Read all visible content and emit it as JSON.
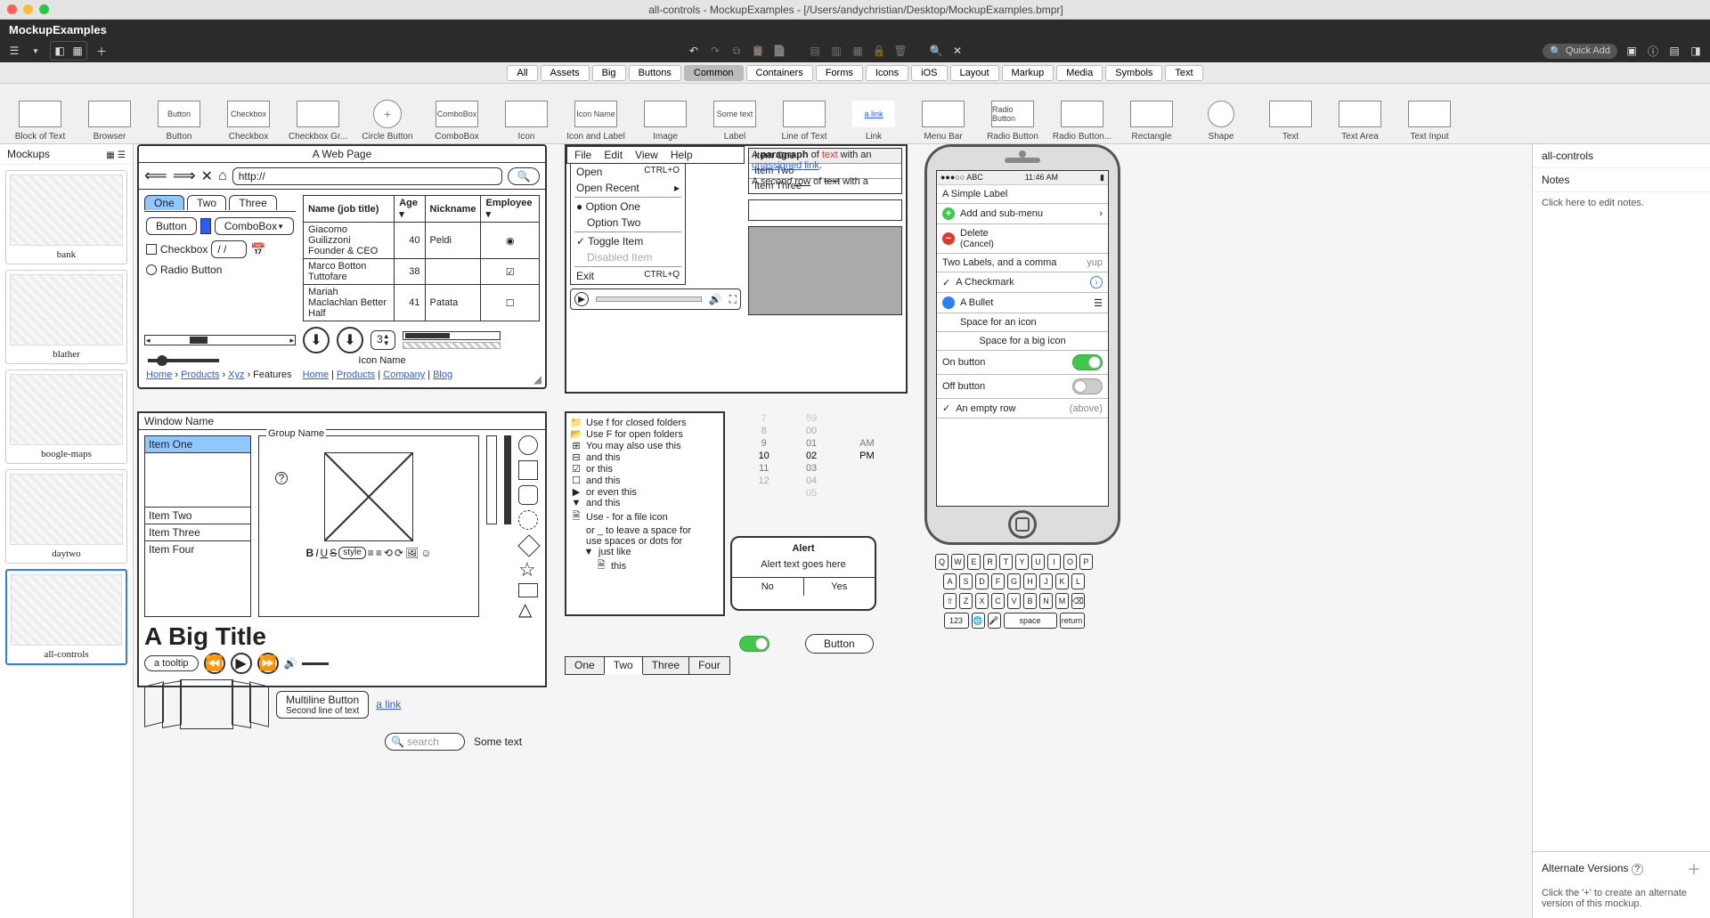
{
  "window": {
    "title": "all-controls - MockupExamples - [/Users/andychristian/Desktop/MockupExamples.bmpr]",
    "app_name": "MockupExamples"
  },
  "quick_add": {
    "placeholder": "Quick Add"
  },
  "categories": [
    "All",
    "Assets",
    "Big",
    "Buttons",
    "Common",
    "Containers",
    "Forms",
    "Icons",
    "iOS",
    "Layout",
    "Markup",
    "Media",
    "Symbols",
    "Text"
  ],
  "controls_strip": [
    {
      "label": "Block of Text"
    },
    {
      "label": "Browser"
    },
    {
      "label": "Button",
      "btn": "Button"
    },
    {
      "label": "Checkbox",
      "btn": "Checkbox"
    },
    {
      "label": "Checkbox Gr..."
    },
    {
      "label": "Circle Button"
    },
    {
      "label": "ComboBox",
      "btn": "ComboBox"
    },
    {
      "label": "Icon"
    },
    {
      "label": "Icon and Label",
      "sub": "Icon Name"
    },
    {
      "label": "Image"
    },
    {
      "label": "Label",
      "sub": "Some text"
    },
    {
      "label": "Line of Text"
    },
    {
      "label": "Link",
      "sub": "a link"
    },
    {
      "label": "Menu Bar"
    },
    {
      "label": "Radio Button",
      "sub": "Radio Button"
    },
    {
      "label": "Radio Button..."
    },
    {
      "label": "Rectangle"
    },
    {
      "label": "Shape"
    },
    {
      "label": "Text"
    },
    {
      "label": "Text Area"
    },
    {
      "label": "Text Input"
    }
  ],
  "mockups": {
    "title": "Mockups",
    "items": [
      "bank",
      "blather",
      "boogle-maps",
      "daytwo",
      "all-controls"
    ],
    "selected": "all-controls"
  },
  "notes": {
    "doc_title": "all-controls",
    "heading": "Notes",
    "placeholder": "Click here to edit notes.",
    "alt_title": "Alternate Versions",
    "alt_help": "Click the '+' to create an alternate version of this mockup."
  },
  "webpage": {
    "title": "A Web Page",
    "url": "http://",
    "tabs": [
      "One",
      "Two",
      "Three"
    ],
    "button": "Button",
    "combobox": "ComboBox",
    "checkbox": "Checkbox",
    "date": "/  /",
    "radio": "Radio Button",
    "table": {
      "headers": [
        "Name (job title)",
        "Age",
        "Nickname",
        "Employee"
      ],
      "rows": [
        [
          "Giacomo Guilizzoni Founder & CEO",
          "40",
          "Peldi",
          "radio-on"
        ],
        [
          "Marco Botton Tuttofare",
          "38",
          "",
          "check-on"
        ],
        [
          "Mariah Maclachlan Better Half",
          "41",
          "Patata",
          "check-off"
        ]
      ]
    },
    "stepper": "3",
    "icon_name": "Icon Name",
    "breadcrumb": [
      "Home",
      "Products",
      "Xyz",
      "Features"
    ],
    "nav": [
      "Home",
      "Products",
      "Company",
      "Blog"
    ]
  },
  "menubar": {
    "items": [
      "File",
      "Edit",
      "View",
      "Help"
    ],
    "menu": [
      {
        "label": "Open",
        "accel": "CTRL+O"
      },
      {
        "label": "Open Recent",
        "sub": true
      },
      {
        "label": "Option One",
        "radio": true,
        "checked": true
      },
      {
        "label": "Option Two",
        "radio": true
      },
      {
        "label": "Toggle Item",
        "check": true,
        "checked": true
      },
      {
        "label": "Disabled Item",
        "disabled": true
      },
      {
        "label": "Exit",
        "accel": "CTRL+Q"
      }
    ],
    "list": [
      "Item One",
      "Item Two",
      "Item Three"
    ],
    "para1_pre": "A ",
    "para1_b": "paragraph",
    "para1_mid": " of ",
    "para1_red": "text",
    "para1_post": " with an ",
    "para1_link": "unassigned link",
    "para2_pre": "A ",
    "para2_i": "second",
    "para2_u": "row",
    "para2_mid": " of ",
    "para2_s": "text",
    "para2_post": " with a "
  },
  "window2": {
    "title": "Window Name",
    "list": [
      "Item One",
      "Item Two",
      "Item Three",
      "Item Four"
    ],
    "group": "Group Name",
    "big_title": "A Big Title",
    "tooltip": "a tooltip",
    "multiline1": "Multiline Button",
    "multiline2": "Second line of text",
    "link": "a link",
    "search_ph": "search",
    "sometext": "Some text",
    "style": "style"
  },
  "tree": {
    "items": [
      {
        "icon": "folder-closed",
        "label": "Use f for closed folders"
      },
      {
        "icon": "folder-open",
        "label": "Use F for open folders"
      },
      {
        "icon": "box-plus",
        "label": "You may also use this"
      },
      {
        "icon": "box-minus",
        "label": "and this"
      },
      {
        "icon": "check",
        "label": "or this"
      },
      {
        "icon": "uncheck",
        "label": "and this"
      },
      {
        "icon": "tri-right",
        "label": "or even this"
      },
      {
        "icon": "tri-down",
        "label": "and this"
      },
      {
        "icon": "file",
        "label": "Use - for a file icon"
      },
      {
        "icon": "none",
        "label": "or _ to leave a space for"
      },
      {
        "icon": "none",
        "label": "use spaces or dots for"
      },
      {
        "icon": "tri-down",
        "label": "just like",
        "indent": 1
      },
      {
        "icon": "file",
        "label": "this",
        "indent": 2
      }
    ]
  },
  "timepicker": {
    "hours": [
      "7",
      "8",
      "9",
      "10",
      "11",
      "12"
    ],
    "mins": [
      "59",
      "00",
      "01",
      "02",
      "03",
      "04",
      "05"
    ],
    "ampm": [
      "AM",
      "PM"
    ]
  },
  "alert": {
    "title": "Alert",
    "body": "Alert text goes here",
    "no": "No",
    "yes": "Yes"
  },
  "pill_button": "Button",
  "tabbar2": [
    "One",
    "Two",
    "Three",
    "Four"
  ],
  "phone": {
    "carrier": "ABC",
    "time": "11:46 AM",
    "rows": [
      {
        "l": "A Simple Label"
      },
      {
        "l": "Add and sub-menu",
        "icon": "green-plus",
        "chev": true
      },
      {
        "l": "Delete",
        "l2": "(Cancel)",
        "icon": "red-minus"
      },
      {
        "l": "Two Labels, and a comma",
        "r": "yup"
      },
      {
        "l": "A Checkmark",
        "icon": "check",
        "chevblue": true
      },
      {
        "l": "A Bullet",
        "icon": "blue-dot",
        "menu": true
      },
      {
        "l": "Space for an icon",
        "pad": true
      },
      {
        "l": "Space for a big icon",
        "center": true
      },
      {
        "l": "On button",
        "toggle": "on"
      },
      {
        "l": "Off button",
        "toggle": "off"
      },
      {
        "l": "An empty row",
        "icon": "check",
        "r": "(above)"
      }
    ]
  },
  "keyboard": {
    "r1": [
      "Q",
      "W",
      "E",
      "R",
      "T",
      "Y",
      "U",
      "I",
      "O",
      "P"
    ],
    "r2": [
      "A",
      "S",
      "D",
      "F",
      "G",
      "H",
      "J",
      "K",
      "L"
    ],
    "r3": [
      "Z",
      "X",
      "C",
      "V",
      "B",
      "N",
      "M"
    ],
    "space": "space",
    "ret": "return",
    "num": "123"
  }
}
